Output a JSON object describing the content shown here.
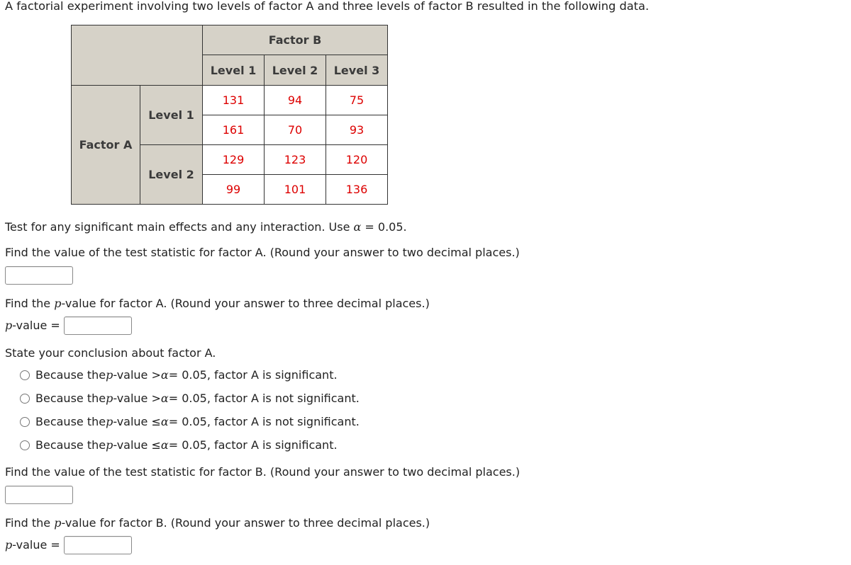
{
  "intro": "A factorial experiment involving two levels of factor A and three levels of factor B resulted in the following data.",
  "table": {
    "factor_b_label": "Factor B",
    "factor_a_label": "Factor A",
    "b_levels": [
      "Level 1",
      "Level 2",
      "Level 3"
    ],
    "a_levels": [
      "Level 1",
      "Level 2"
    ],
    "rows": [
      [
        "131",
        "94",
        "75"
      ],
      [
        "161",
        "70",
        "93"
      ],
      [
        "129",
        "123",
        "120"
      ],
      [
        "99",
        "101",
        "136"
      ]
    ]
  },
  "instruction": {
    "text": "Test for any significant main effects and any interaction. Use ",
    "alpha_symbol": "α",
    "alpha_value": " = 0.05."
  },
  "q_stat_a": {
    "text": "Find the value of the test statistic for factor A. (Round your answer to two decimal places.)",
    "value": ""
  },
  "q_p_a": {
    "pre": "Find the ",
    "p": "p",
    "post": "-value for factor A. (Round your answer to three decimal places.)",
    "label_post": "-value =",
    "value": ""
  },
  "conclusion_a": {
    "prompt": "State your conclusion about factor A.",
    "options": [
      {
        "pre": "Because the ",
        "p": "p",
        "mid": "-value > ",
        "a": "α",
        "post": " = 0.05, factor A is significant."
      },
      {
        "pre": "Because the ",
        "p": "p",
        "mid": "-value > ",
        "a": "α",
        "post": " = 0.05, factor A is not significant."
      },
      {
        "pre": "Because the ",
        "p": "p",
        "mid": "-value ≤ ",
        "a": "α",
        "post": " = 0.05, factor A is not significant."
      },
      {
        "pre": "Because the ",
        "p": "p",
        "mid": "-value ≤ ",
        "a": "α",
        "post": " = 0.05, factor A is significant."
      }
    ]
  },
  "q_stat_b": {
    "text": "Find the value of the test statistic for factor B. (Round your answer to two decimal places.)",
    "value": ""
  },
  "q_p_b": {
    "pre": "Find the ",
    "p": "p",
    "post": "-value for factor B. (Round your answer to three decimal places.)",
    "label_post": "-value =",
    "value": ""
  }
}
